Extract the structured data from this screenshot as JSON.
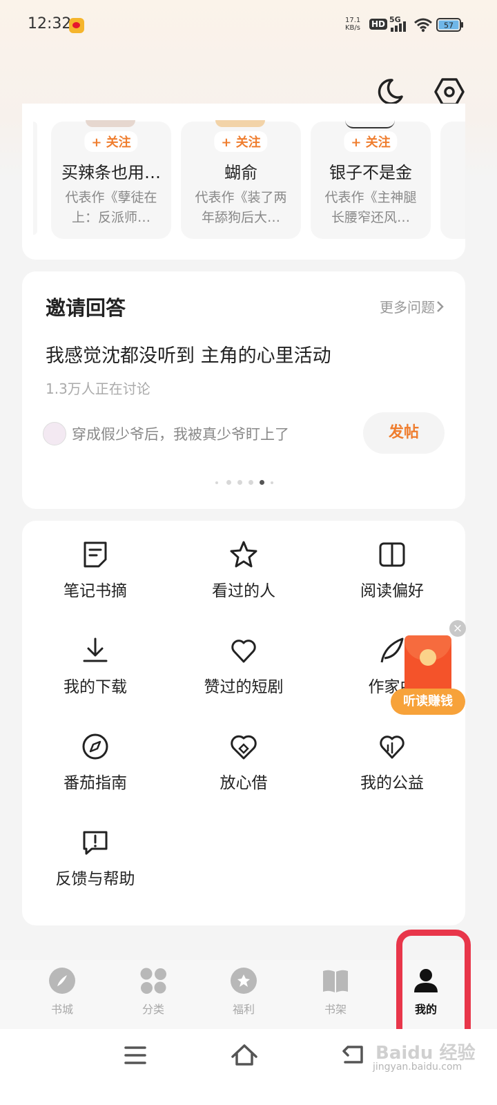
{
  "status_bar": {
    "time": "12:32",
    "net_speed": "17.1",
    "net_unit": "KB/s",
    "hd": "HD",
    "signal_label": "5G",
    "battery": "57"
  },
  "header": {
    "moon_icon": "moon-icon",
    "settings_icon": "settings-hex-icon"
  },
  "authors": [
    {
      "follow": "+ 关注",
      "name": "买辣条也用…",
      "desc": "代表作《孽徒在上：反派师…"
    },
    {
      "follow": "+ 关注",
      "name": "蝴俞",
      "desc": "代表作《装了两年舔狗后大…"
    },
    {
      "follow": "+ 关注",
      "name": "银子不是金",
      "desc": "代表作《主神腿长腰窄还风…"
    }
  ],
  "invite": {
    "title": "邀请回答",
    "more": "更多问题",
    "question": "我感觉沈都没听到 主角的心里活动",
    "discussing": "1.3万人正在讨论",
    "book": "穿成假少爷后，我被真少爷盯上了",
    "post": "发帖",
    "pager": {
      "count": 6,
      "active": 4
    }
  },
  "grid": [
    {
      "label": "笔记书摘",
      "icon": "note-icon"
    },
    {
      "label": "看过的人",
      "icon": "star-icon"
    },
    {
      "label": "阅读偏好",
      "icon": "book-open-icon"
    },
    {
      "label": "我的下载",
      "icon": "download-icon"
    },
    {
      "label": "赞过的短剧",
      "icon": "heart-icon"
    },
    {
      "label": "作家中",
      "icon": "quill-icon"
    },
    {
      "label": "番茄指南",
      "icon": "compass-icon"
    },
    {
      "label": "放心借",
      "icon": "shield-heart-icon"
    },
    {
      "label": "我的公益",
      "icon": "charity-heart-icon"
    },
    {
      "label": "反馈与帮助",
      "icon": "feedback-icon"
    }
  ],
  "promo": {
    "label": "听读赚钱"
  },
  "tabs": [
    {
      "label": "书城",
      "icon": "compass-filled-icon"
    },
    {
      "label": "分类",
      "icon": "grid-icon"
    },
    {
      "label": "福利",
      "icon": "gift-icon"
    },
    {
      "label": "书架",
      "icon": "bookshelf-icon"
    },
    {
      "label": "我的",
      "icon": "person-icon",
      "active": true
    }
  ],
  "colors": {
    "accent": "#ef7d2e",
    "highlight": "#e8364a",
    "promo": "#f4532a"
  },
  "watermark": {
    "text": "Baidu经验",
    "sub": "jingyan.baidu.com"
  }
}
